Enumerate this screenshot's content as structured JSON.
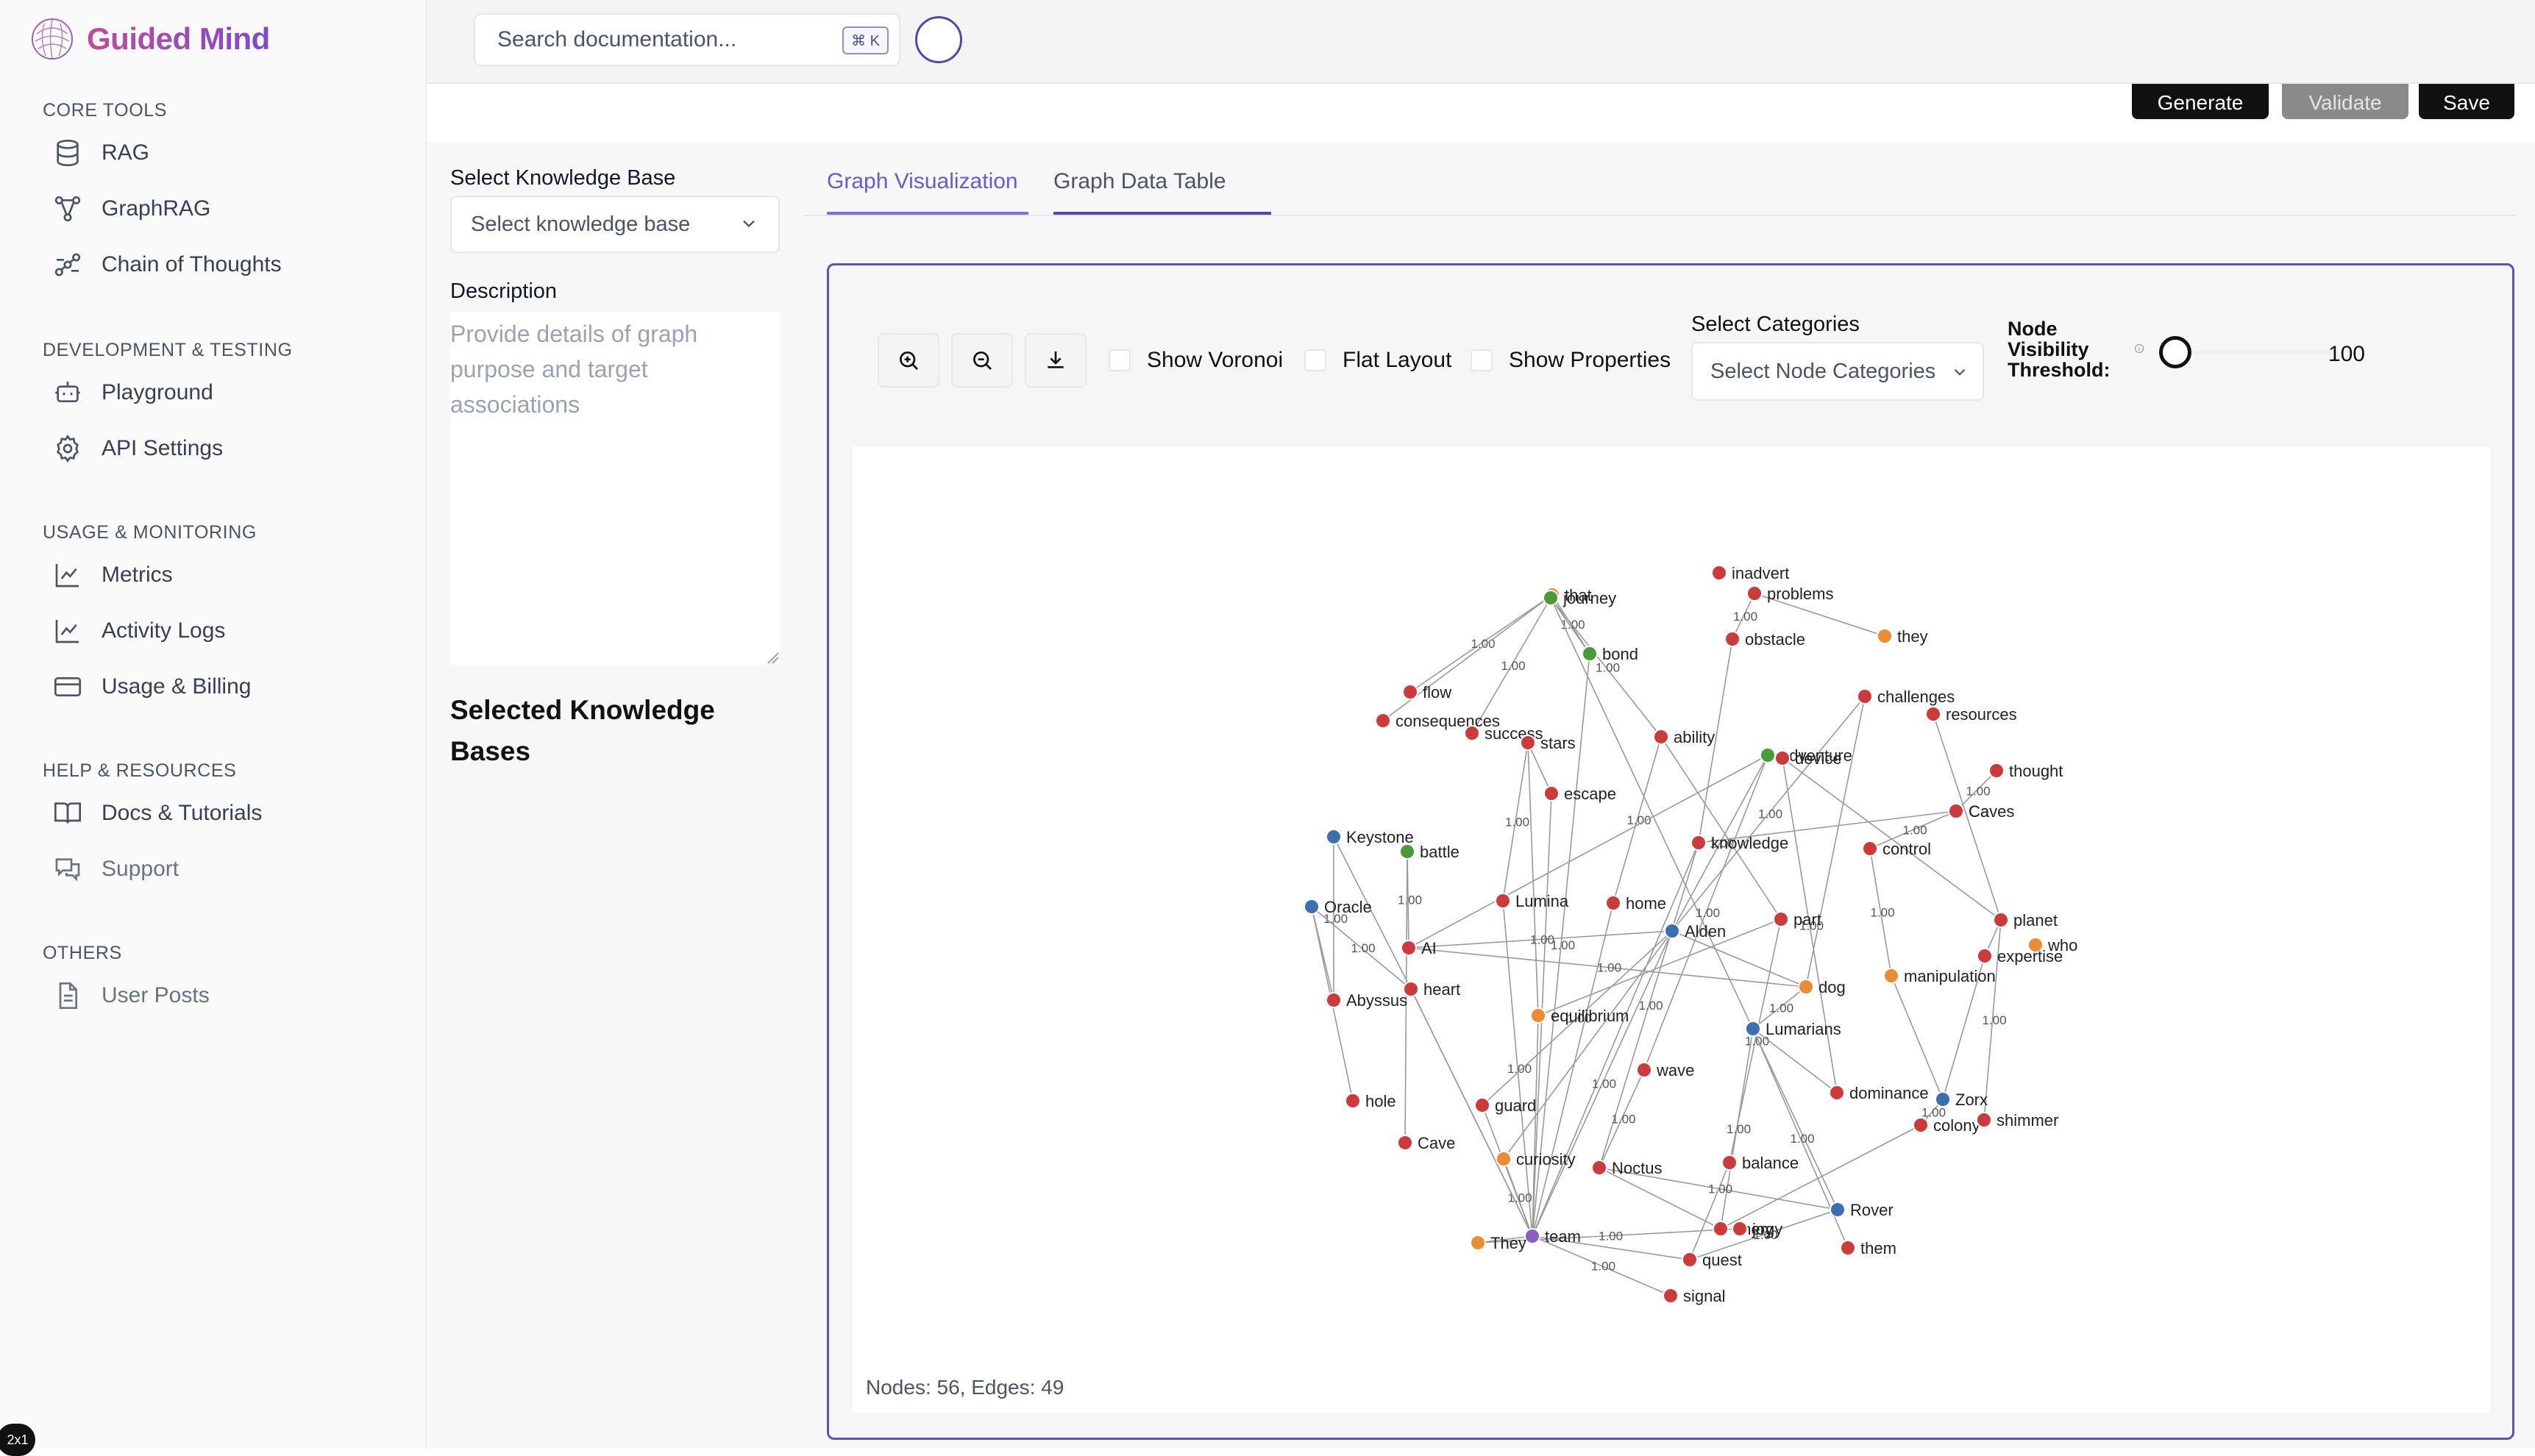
{
  "brand": {
    "name": "Guided Mind"
  },
  "sidebar": {
    "sections": [
      {
        "title": "CORE TOOLS",
        "items": [
          {
            "label": "RAG",
            "icon": "database-icon"
          },
          {
            "label": "GraphRAG",
            "icon": "graph-icon"
          },
          {
            "label": "Chain of Thoughts",
            "icon": "workflow-icon"
          }
        ]
      },
      {
        "title": "DEVELOPMENT & TESTING",
        "items": [
          {
            "label": "Playground",
            "icon": "bot-icon"
          },
          {
            "label": "API Settings",
            "icon": "gear-icon"
          }
        ]
      },
      {
        "title": "USAGE & MONITORING",
        "items": [
          {
            "label": "Metrics",
            "icon": "line-chart-icon"
          },
          {
            "label": "Activity Logs",
            "icon": "line-chart-icon"
          },
          {
            "label": "Usage & Billing",
            "icon": "credit-card-icon"
          }
        ]
      },
      {
        "title": "HELP & RESOURCES",
        "items": [
          {
            "label": "Docs & Tutorials",
            "icon": "book-icon"
          },
          {
            "label": "Support",
            "icon": "chat-icon"
          }
        ]
      },
      {
        "title": "OTHERS",
        "items": [
          {
            "label": "User Posts",
            "icon": "document-icon"
          }
        ]
      }
    ],
    "badge": "2x1"
  },
  "topbar": {
    "search_placeholder": "Search documentation...",
    "shortcut": "⌘ K"
  },
  "actions": {
    "generate": "Generate",
    "validate": "Validate",
    "save": "Save"
  },
  "form": {
    "kb_label": "Select Knowledge Base",
    "kb_placeholder": "Select knowledge base",
    "desc_label": "Description",
    "desc_placeholder": "Provide details of graph purpose and target associations",
    "selected_title": "Selected Knowledge Bases"
  },
  "tabs": {
    "viz": "Graph Visualization",
    "table": "Graph Data Table"
  },
  "graph_controls": {
    "show_voronoi": "Show Voronoi",
    "flat_layout": "Flat Layout",
    "show_properties": "Show Properties",
    "categories_label": "Select Categories",
    "categories_placeholder": "Select Node Categories",
    "threshold_label": "Node Visibility Threshold:",
    "threshold_value": "100"
  },
  "graph": {
    "stats": "Nodes: 56, Edges: 49",
    "colors": {
      "red": "#cc3b3b",
      "blue": "#3b6fb0",
      "green": "#4a9a3a",
      "orange": "#ea8c35",
      "purple": "#8b5fc1"
    },
    "edge_weight_label": "1.00",
    "nodes": [
      {
        "label": "that",
        "c": "orange"
      },
      {
        "label": "journey",
        "c": "green"
      },
      {
        "label": "inadvert",
        "c": "red"
      },
      {
        "label": "problems",
        "c": "red"
      },
      {
        "label": "they",
        "c": "orange"
      },
      {
        "label": "obstacle",
        "c": "red"
      },
      {
        "label": "bond",
        "c": "green"
      },
      {
        "label": "flow",
        "c": "red"
      },
      {
        "label": "consequences",
        "c": "red"
      },
      {
        "label": "success",
        "c": "red"
      },
      {
        "label": "stars",
        "c": "red"
      },
      {
        "label": "ability",
        "c": "red"
      },
      {
        "label": "adventure",
        "c": "green"
      },
      {
        "label": "device",
        "c": "red"
      },
      {
        "label": "challenges",
        "c": "red"
      },
      {
        "label": "resources",
        "c": "red"
      },
      {
        "label": "thought",
        "c": "red"
      },
      {
        "label": "escape",
        "c": "red"
      },
      {
        "label": "Ca",
        "c": "red"
      },
      {
        "label": "Caves",
        "c": "red"
      },
      {
        "label": "Keystone",
        "c": "blue"
      },
      {
        "label": "battle",
        "c": "green"
      },
      {
        "label": "knowledge",
        "c": "red"
      },
      {
        "label": "control",
        "c": "red"
      },
      {
        "label": "Oracle",
        "c": "blue"
      },
      {
        "label": "Lumina",
        "c": "red"
      },
      {
        "label": "home",
        "c": "red"
      },
      {
        "label": "Alden",
        "c": "blue"
      },
      {
        "label": "part",
        "c": "red"
      },
      {
        "label": "planet",
        "c": "red"
      },
      {
        "label": "who",
        "c": "orange"
      },
      {
        "label": "expertise",
        "c": "red"
      },
      {
        "label": "AI",
        "c": "red"
      },
      {
        "label": "heart",
        "c": "red"
      },
      {
        "label": "dog",
        "c": "orange"
      },
      {
        "label": "manipulation",
        "c": "orange"
      },
      {
        "label": "Abyssus",
        "c": "red"
      },
      {
        "label": "equilibrium",
        "c": "orange"
      },
      {
        "label": "Lumarians",
        "c": "blue"
      },
      {
        "label": "wave",
        "c": "red"
      },
      {
        "label": "hole",
        "c": "red"
      },
      {
        "label": "guard",
        "c": "red"
      },
      {
        "label": "dominance",
        "c": "red"
      },
      {
        "label": "Zorx",
        "c": "blue"
      },
      {
        "label": "colony",
        "c": "red"
      },
      {
        "label": "shimmer",
        "c": "red"
      },
      {
        "label": "Cave",
        "c": "red"
      },
      {
        "label": "curiosity",
        "c": "orange"
      },
      {
        "label": "Noctus",
        "c": "red"
      },
      {
        "label": "balance",
        "c": "red"
      },
      {
        "label": "Rover",
        "c": "blue"
      },
      {
        "label": "energy",
        "c": "red"
      },
      {
        "label": "joy",
        "c": "red"
      },
      {
        "label": "team",
        "c": "purple"
      },
      {
        "label": "They",
        "c": "orange"
      },
      {
        "label": "them",
        "c": "red"
      },
      {
        "label": "quest",
        "c": "red"
      },
      {
        "label": "signal",
        "c": "red"
      }
    ],
    "edges": [
      [
        "that",
        "flow"
      ],
      [
        "that",
        "consequences"
      ],
      [
        "that",
        "bond"
      ],
      [
        "journey",
        "bond"
      ],
      [
        "journey",
        "ability"
      ],
      [
        "journey",
        "Rover"
      ],
      [
        "journey",
        "success"
      ],
      [
        "problems",
        "they"
      ],
      [
        "problems",
        "obstacle"
      ],
      [
        "obstacle",
        "knowledge"
      ],
      [
        "bond",
        "team"
      ],
      [
        "stars",
        "escape"
      ],
      [
        "stars",
        "Lumina"
      ],
      [
        "stars",
        "equilibrium"
      ],
      [
        "ability",
        "home"
      ],
      [
        "ability",
        "part"
      ],
      [
        "adventure",
        "Alden"
      ],
      [
        "adventure",
        "AI"
      ],
      [
        "adventure",
        "wave"
      ],
      [
        "device",
        "planet"
      ],
      [
        "device",
        "dominance"
      ],
      [
        "challenges",
        "dog"
      ],
      [
        "challenges",
        "Alden"
      ],
      [
        "resources",
        "planet"
      ],
      [
        "thought",
        "Ca"
      ],
      [
        "Ca",
        "knowledge"
      ],
      [
        "Ca",
        "control"
      ],
      [
        "escape",
        "team"
      ],
      [
        "Keystone",
        "Abyssus"
      ],
      [
        "Keystone",
        "heart"
      ],
      [
        "battle",
        "AI"
      ],
      [
        "battle",
        "Cave"
      ],
      [
        "knowledge",
        "Noctus"
      ],
      [
        "knowledge",
        "team"
      ],
      [
        "control",
        "manipulation"
      ],
      [
        "Oracle",
        "hole"
      ],
      [
        "Oracle",
        "heart"
      ],
      [
        "Oracle",
        "Abyssus"
      ],
      [
        "Lumina",
        "team"
      ],
      [
        "home",
        "team"
      ],
      [
        "Alden",
        "AI"
      ],
      [
        "Alden",
        "curiosity"
      ],
      [
        "Alden",
        "team"
      ],
      [
        "Alden",
        "dog"
      ],
      [
        "Alden",
        "guard"
      ],
      [
        "part",
        "equilibrium"
      ],
      [
        "part",
        "balance"
      ],
      [
        "planet",
        "expertise"
      ],
      [
        "planet",
        "shimmer"
      ],
      [
        "expertise",
        "Zorx"
      ],
      [
        "AI",
        "dog"
      ],
      [
        "heart",
        "team"
      ],
      [
        "dog",
        "Lumarians"
      ],
      [
        "manipulation",
        "Zorx"
      ],
      [
        "Lumarians",
        "energy"
      ],
      [
        "Lumarians",
        "dominance"
      ],
      [
        "Lumarians",
        "them"
      ],
      [
        "equilibrium",
        "team"
      ],
      [
        "wave",
        "Noctus"
      ],
      [
        "guard",
        "team"
      ],
      [
        "Zorx",
        "colony"
      ],
      [
        "colony",
        "energy"
      ],
      [
        "curiosity",
        "team"
      ],
      [
        "Noctus",
        "energy"
      ],
      [
        "Noctus",
        "Rover"
      ],
      [
        "balance",
        "quest"
      ],
      [
        "Rover",
        "quest"
      ],
      [
        "team",
        "They"
      ],
      [
        "team",
        "signal"
      ],
      [
        "team",
        "quest"
      ],
      [
        "They",
        "joy"
      ],
      [
        "heart",
        "team"
      ]
    ]
  }
}
